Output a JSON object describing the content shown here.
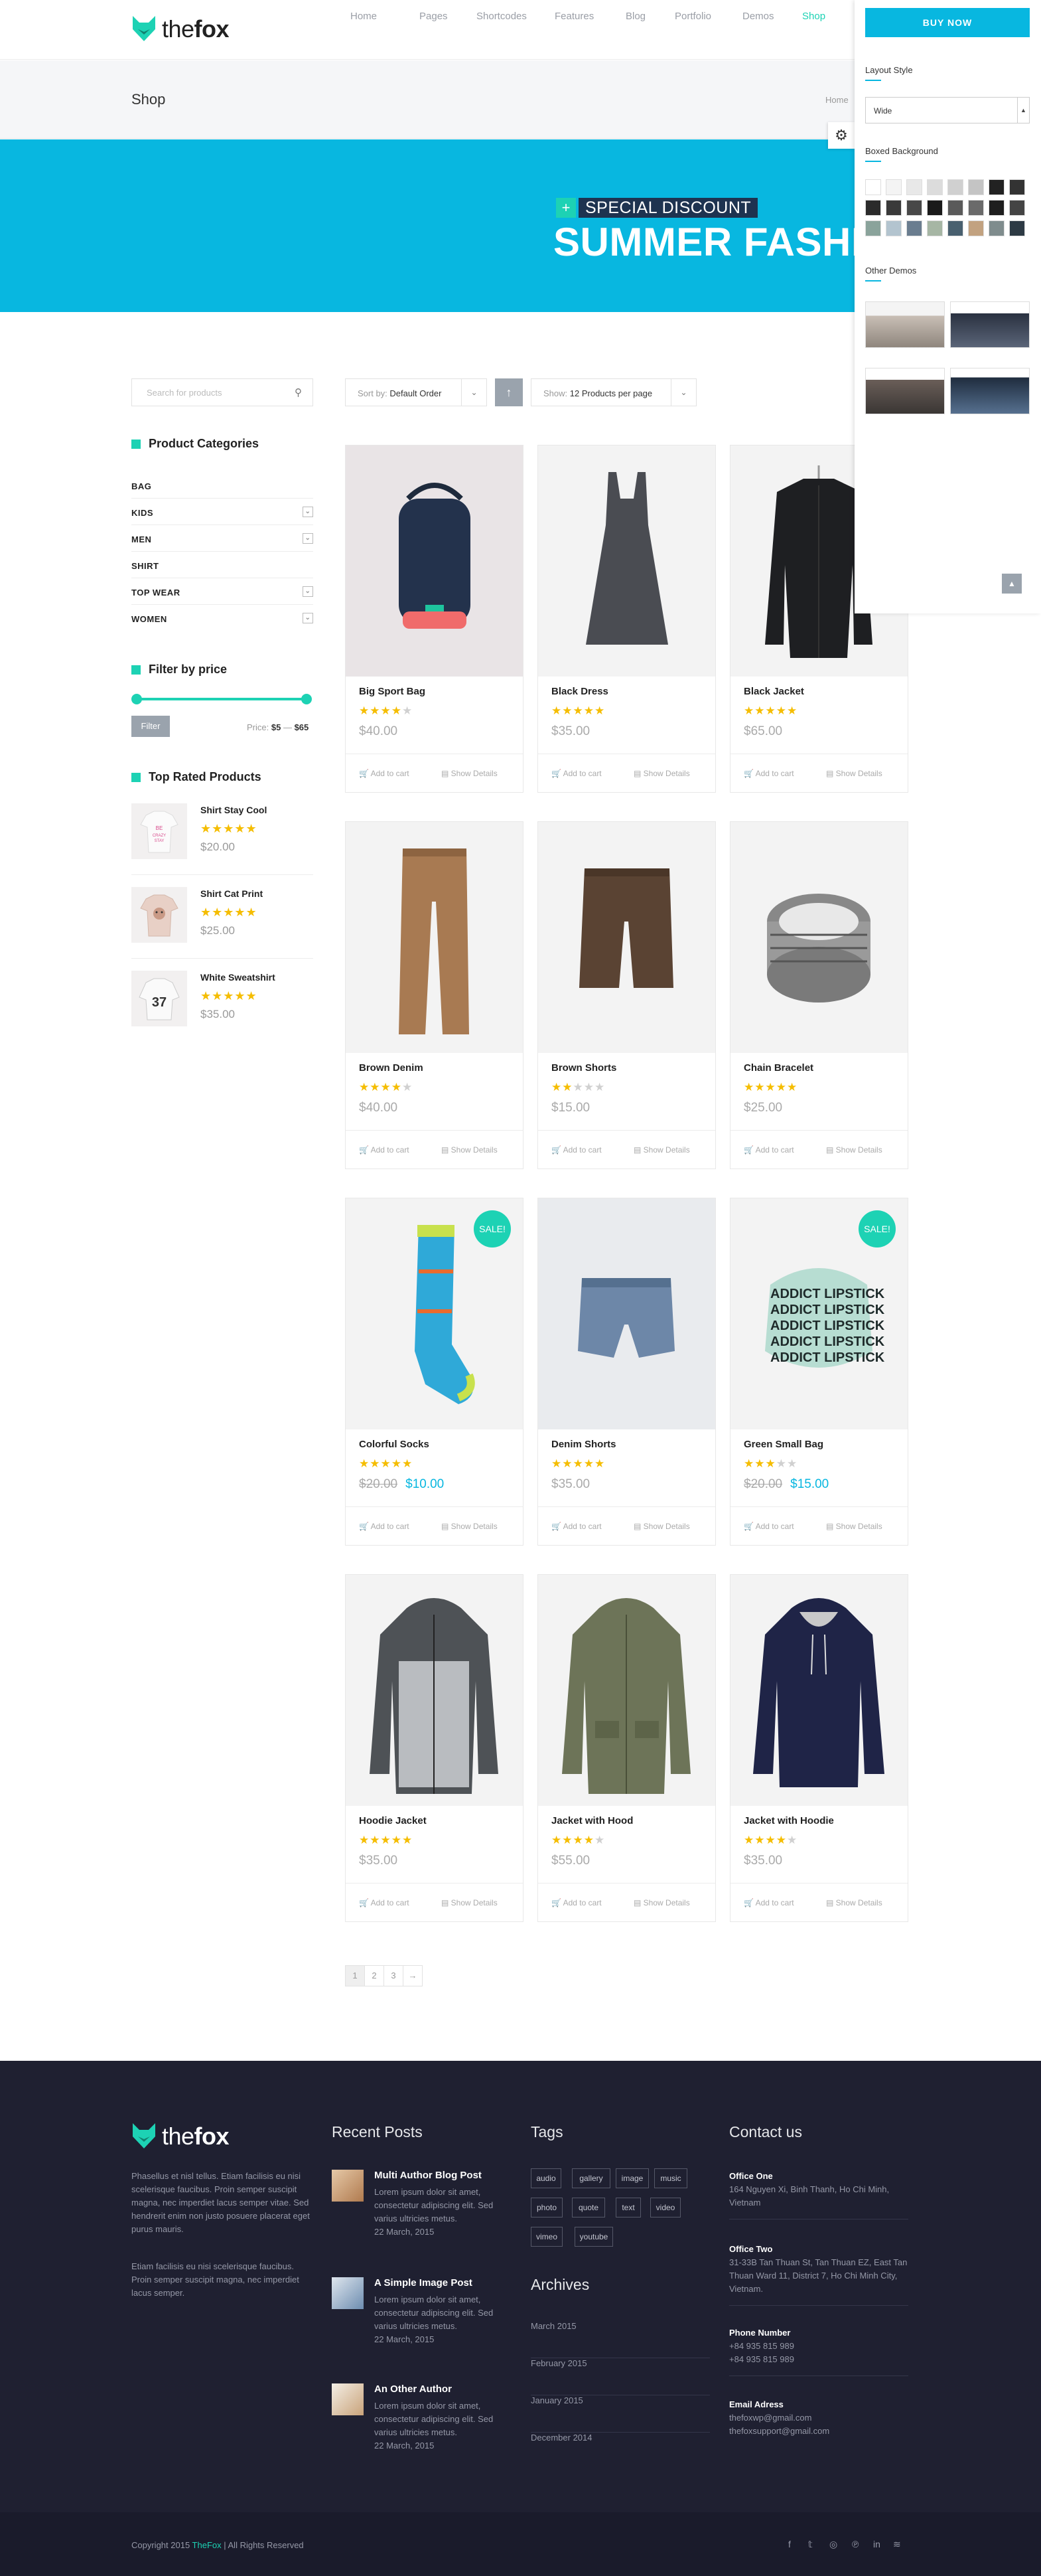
{
  "brand": {
    "logo_a": "the",
    "logo_b": "fox"
  },
  "nav": {
    "items": [
      "Home",
      "Pages",
      "Shortcodes",
      "Features",
      "Blog",
      "Portfolio",
      "Demos",
      "Shop"
    ],
    "active": "Shop"
  },
  "title_bar": {
    "title": "Shop",
    "breadcrumb": "Home"
  },
  "banner": {
    "subtitle": "SPECIAL DISCOUNT",
    "title": "SUMMER FASHION",
    "plus": "+"
  },
  "sidebar": {
    "search_placeholder": "Search for products",
    "categories_title": "Product Categories",
    "categories": [
      {
        "label": "BAG"
      },
      {
        "label": "KIDS"
      },
      {
        "label": "MEN"
      },
      {
        "label": "SHIRT"
      },
      {
        "label": "TOP WEAR"
      },
      {
        "label": "WOMEN"
      }
    ],
    "filter_title": "Filter by price",
    "filter_button": "Filter",
    "price_label": "Price:",
    "price_min": "$5",
    "price_sep": "—",
    "price_max": "$65",
    "top_rated_title": "Top Rated Products",
    "top_rated": [
      {
        "name": "Shirt Stay Cool",
        "price": "$20.00",
        "rating": 5
      },
      {
        "name": "Shirt Cat Print",
        "price": "$25.00",
        "rating": 5
      },
      {
        "name": "White Sweatshirt",
        "price": "$35.00",
        "rating": 5
      }
    ]
  },
  "toolbar": {
    "sort_label": "Sort by:",
    "sort_value": "Default Order",
    "show_label": "Show:",
    "show_value": "12 Products per page"
  },
  "card_actions": {
    "add": "Add to cart",
    "details": "Show Details"
  },
  "products": [
    {
      "name": "Big Sport Bag",
      "price": "$40.00",
      "rating": 4,
      "sale": false
    },
    {
      "name": "Black Dress",
      "price": "$35.00",
      "rating": 5,
      "sale": false
    },
    {
      "name": "Black Jacket",
      "price": "$65.00",
      "rating": 5,
      "sale": false
    },
    {
      "name": "Brown Denim",
      "price": "$40.00",
      "rating": 4,
      "sale": false
    },
    {
      "name": "Brown Shorts",
      "price": "$15.00",
      "rating": 2,
      "sale": false
    },
    {
      "name": "Chain Bracelet",
      "price": "$25.00",
      "rating": 5,
      "sale": false
    },
    {
      "name": "Colorful Socks",
      "old_price": "$20.00",
      "price": "$10.00",
      "rating": 5,
      "sale": true
    },
    {
      "name": "Denim Shorts",
      "price": "$35.00",
      "rating": 5,
      "sale": false
    },
    {
      "name": "Green Small Bag",
      "old_price": "$20.00",
      "price": "$15.00",
      "rating": 3,
      "sale": true
    },
    {
      "name": "Hoodie Jacket",
      "price": "$35.00",
      "rating": 5,
      "sale": false
    },
    {
      "name": "Jacket with Hood",
      "price": "$55.00",
      "rating": 4,
      "sale": false
    },
    {
      "name": "Jacket with Hoodie",
      "price": "$35.00",
      "rating": 4,
      "sale": false
    }
  ],
  "sale_badge": "SALE!",
  "lipstick_text": "ADDICT LIPSTICK",
  "pagination": {
    "pages": [
      "1",
      "2",
      "3"
    ],
    "next": "→"
  },
  "footer": {
    "about_1": "Phasellus et nisl tellus. Etiam facilisis eu nisi scelerisque faucibus. Proin semper suscipit magna, nec imperdiet lacus semper vitae. Sed hendrerit enim non justo posuere placerat eget purus mauris.",
    "about_2": "Etiam facilisis eu nisi scelerisque faucibus. Proin semper suscipit magna, nec imperdiet lacus semper.",
    "recent_title": "Recent Posts",
    "posts": [
      {
        "title": "Multi Author Blog Post",
        "excerpt": "Lorem ipsum dolor sit amet, consectetur adipiscing elit. Sed varius ultricies metus.",
        "date": "22 March, 2015"
      },
      {
        "title": "A Simple Image Post",
        "excerpt": "Lorem ipsum dolor sit amet, consectetur adipiscing elit. Sed varius ultricies metus.",
        "date": "22 March, 2015"
      },
      {
        "title": "An Other Author",
        "excerpt": "Lorem ipsum dolor sit amet, consectetur adipiscing elit. Sed varius ultricies metus.",
        "date": "22 March, 2015"
      }
    ],
    "tags_title": "Tags",
    "tags": [
      "audio",
      "gallery",
      "image",
      "music",
      "photo",
      "quote",
      "text",
      "video",
      "vimeo",
      "youtube"
    ],
    "archives_title": "Archives",
    "archives": [
      "March 2015",
      "February 2015",
      "January 2015",
      "December 2014"
    ],
    "contact_title": "Contact us",
    "contacts": [
      {
        "label": "Office One",
        "value": "164 Nguyen Xi, Binh Thanh, Ho Chi Minh, Vietnam"
      },
      {
        "label": "Office Two",
        "value": "31-33B Tan Thuan St, Tan Thuan EZ, East Tan Thuan Ward 11, District 7, Ho Chi Minh City, Vietnam."
      },
      {
        "label": "Phone Number",
        "value": "+84 935 815 989",
        "value2": "+84 935 815 989"
      },
      {
        "label": "Email Adress",
        "value": "thefoxwp@gmail.com",
        "value2": "thefoxsupport@gmail.com"
      }
    ],
    "copyright_a": "Copyright 2015 ",
    "copyright_brand": "TheFox",
    "copyright_b": " | All Rights Reserved",
    "social": [
      "f",
      "𝕥",
      "◎",
      "℗",
      "in",
      "≋"
    ]
  },
  "panel": {
    "buy_now": "BUY NOW",
    "layout_title": "Layout Style",
    "layout_value": "Wide",
    "boxed_title": "Boxed Background",
    "demos_title": "Other Demos"
  },
  "colors": {
    "accent": "#08b7e0",
    "green": "#1dd2b4",
    "star": "#f5bd00",
    "footer_bg": "#1f2031"
  }
}
